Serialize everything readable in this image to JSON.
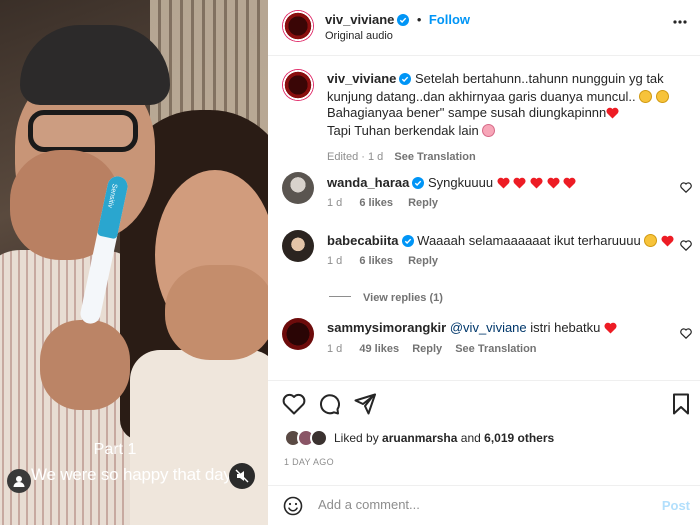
{
  "media": {
    "pregnancy_test_label": "Sensitiv",
    "caption_part": "Part 1",
    "caption_text": "We were so happy that day..."
  },
  "header": {
    "username": "viv_viviane",
    "follow_label": "Follow",
    "separator": "•",
    "audio": "Original audio"
  },
  "caption": {
    "username": "viv_viviane",
    "text_line1": "Setelah bertahunn..tahunn nungguin yg tak",
    "text_line2": "kunjung datang..dan akhirnyaa garis duanya muncul..",
    "text_line3": "Bahagianyaa bener\" sampe susah diungkapinnn",
    "text_line4": "Tapi Tuhan berkendak lain",
    "edited": "Edited",
    "dot": "·",
    "time": "1 d",
    "see_translation": "See Translation"
  },
  "comments": [
    {
      "username": "wanda_haraa",
      "text": "Syngkuuuu",
      "time": "1 d",
      "likes": "6 likes",
      "reply": "Reply"
    },
    {
      "username": "babecabiita",
      "text": "Waaaah selamaaaaaat ikut terharuuuu",
      "time": "1 d",
      "likes": "6 likes",
      "reply": "Reply",
      "view_replies": "View replies (1)"
    },
    {
      "username": "sammysimorangkir",
      "mention": "@viv_viviane",
      "text": "istri hebatku",
      "time": "1 d",
      "likes": "49 likes",
      "reply": "Reply",
      "see_translation": "See Translation"
    }
  ],
  "likes": {
    "liked_by": "Liked by",
    "user": "aruanmarsha",
    "and": "and",
    "others": "6,019 others"
  },
  "timeago": "1 DAY AGO",
  "add_comment": {
    "placeholder": "Add a comment...",
    "post_label": "Post"
  },
  "colors": {
    "accent_blue": "#0095f6",
    "heart_red": "#ed4956",
    "muted_gray": "#8e8e8e"
  }
}
